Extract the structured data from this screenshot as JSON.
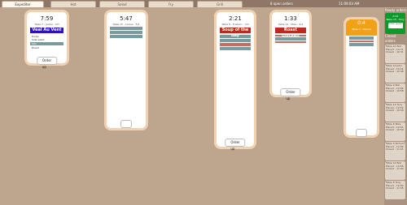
{
  "tabs": [
    {
      "label": "Expediter"
    },
    {
      "label": "Hot"
    },
    {
      "label": "Salad"
    },
    {
      "label": "Fry"
    },
    {
      "label": "Grill"
    }
  ],
  "top": {
    "open": "8 open orders",
    "time": "11:09:03 AM"
  },
  "ready": {
    "head": "Ready orders",
    "tk": "2:18",
    "tbl": "Table 13 - Tony",
    "btn": "Order given"
  },
  "closed": {
    "head": "Closed orders",
    "items": [
      "Table 21 Bob Placed - 10:31 Closed - 10:31",
      "Table 10 John Placed - 10:44 Closed - 10:48",
      "Table 4 Bob Placed - 10:54 Closed - 10:58",
      "Table 14 Tony Placed - 10:59 Closed - 10:59",
      "Table 6 Mike Placed - 10:55 Closed - 10:59",
      "Table 3 Richard Placed - 10:56 Closed - 11:01",
      "Table 12 Bob Placed - 10:58 Closed - 11:04",
      "Table 8 Tony Placed - 10:59 Closed - 11:05"
    ]
  },
  "tickets": [
    {
      "time": "7:59",
      "sub": "Table 7 - Jackie - 4/3",
      "banner": "Veal Au Vent",
      "items": [
        "Puree",
        "Side salad"
      ],
      "sec": [
        "Mini"
      ],
      "items2": [
        "Bread"
      ],
      "btn": "Order up"
    },
    {
      "time": "5:47",
      "sub": "Table 15 - Louise - 5/3",
      "banner": "",
      "items": []
    },
    {
      "time": "2:21",
      "sub": "Table 8 - Frederic - 3/3",
      "banner": "Soup of the day",
      "btn": "Order up"
    },
    {
      "time": "1:33",
      "sub": "Table 11 - Mike - 4/4",
      "banner": "Roast chicken",
      "btn": "Order up"
    }
  ],
  "orange": {
    "time": "0:4",
    "sub": "Table 3 - Wanda"
  }
}
